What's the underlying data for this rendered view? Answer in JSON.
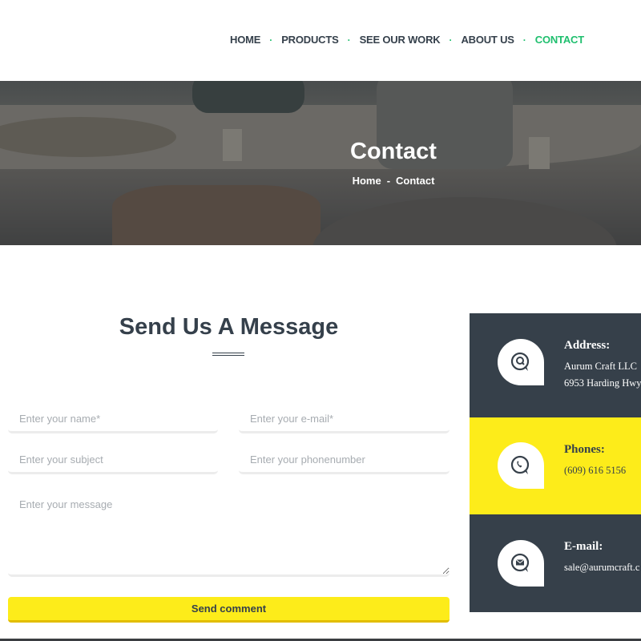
{
  "nav": {
    "items": [
      {
        "label": "HOME",
        "active": false
      },
      {
        "label": "PRODUCTS",
        "active": false
      },
      {
        "label": "SEE OUR WORK",
        "active": false
      },
      {
        "label": "ABOUT US",
        "active": false
      },
      {
        "label": "CONTACT",
        "active": true
      }
    ],
    "separator": "·",
    "accent_color": "#1fbf6e"
  },
  "hero": {
    "title": "Contact",
    "breadcrumb": [
      "Home",
      "-",
      "Contact"
    ]
  },
  "form": {
    "title": "Send Us A Message",
    "fields": {
      "name": {
        "placeholder": "Enter your name*",
        "value": ""
      },
      "email": {
        "placeholder": "Enter your e-mail*",
        "value": ""
      },
      "subject": {
        "placeholder": "Enter your subject",
        "value": ""
      },
      "phone": {
        "placeholder": "Enter your phonenumber",
        "value": ""
      },
      "message": {
        "placeholder": "Enter your message",
        "value": ""
      }
    },
    "submit_label": "Send comment",
    "button_color": "#fdec1a"
  },
  "contact_info": [
    {
      "icon": "location-search-icon",
      "title": "Address:",
      "lines": [
        "Aurum Craft LLC",
        "6953 Harding Hwy"
      ],
      "theme": "dark"
    },
    {
      "icon": "phone-icon",
      "title": "Phones:",
      "lines": [
        "(609) 616 5156"
      ],
      "theme": "yellow"
    },
    {
      "icon": "envelope-icon",
      "title": "E-mail:",
      "lines": [
        "sale@aurumcraft.c"
      ],
      "theme": "dark"
    }
  ]
}
